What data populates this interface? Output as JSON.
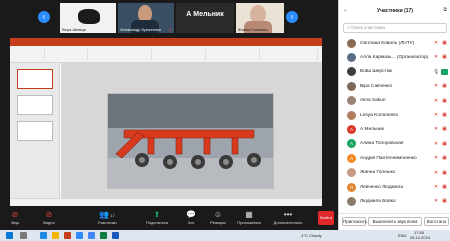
{
  "video_strip": {
    "tiles": [
      {
        "name": "Вера Шевчук"
      },
      {
        "name": "Олександр Христенко"
      },
      {
        "name": "А Мельник"
      },
      {
        "name": "Жанна Голешко"
      }
    ]
  },
  "participants": {
    "title": "Участники (17)",
    "search_placeholder": "Поиск участника",
    "list": [
      {
        "name": "Світлана Коваль (ЛНТУ)",
        "initial": "",
        "color": "#8a6a4f",
        "mic": "off",
        "cam": "off"
      },
      {
        "name": "Алла Кармазь... (Организатор)",
        "initial": "",
        "color": "#5a6d86",
        "mic": "off",
        "cam": "off"
      },
      {
        "name": "Вова Шерстюк",
        "initial": "",
        "color": "#3f3f3f",
        "mic": "on",
        "cam": "on"
      },
      {
        "name": "Віра Савченко",
        "initial": "",
        "color": "#7d6a5a",
        "mic": "off",
        "cam": "off"
      },
      {
        "name": "Alina Sakun",
        "initial": "",
        "color": "#9a8375",
        "mic": "off",
        "cam": "off"
      },
      {
        "name": "Lesya Kononenko",
        "initial": "",
        "color": "#b07d62",
        "mic": "off",
        "cam": "off"
      },
      {
        "name": "А Мельник",
        "initial": "А",
        "color": "#d9362b",
        "mic": "off",
        "cam": "off"
      },
      {
        "name": "Алина Топоровская",
        "initial": "А",
        "color": "#19a365",
        "mic": "off",
        "cam": "off"
      },
      {
        "name": "Андрій Пантелеймоненко",
        "initial": "А",
        "color": "#f08a24",
        "mic": "off",
        "cam": "off"
      },
      {
        "name": "Жанна Голешко",
        "initial": "",
        "color": "#c89a82",
        "mic": "off",
        "cam": "off"
      },
      {
        "name": "Левченко Людмила",
        "initial": "Л",
        "color": "#e3852e",
        "mic": "off",
        "cam": "off"
      },
      {
        "name": "Людмила Бойко",
        "initial": "",
        "color": "#8b7b6b",
        "mic": "off",
        "cam": "off"
      }
    ],
    "buttons": {
      "invite": "Пригласить",
      "mute_all": "Выключить звук всем",
      "restore": "Восстано"
    }
  },
  "toolbar": {
    "audio": "Звук",
    "video": "Видео",
    "participants": "Участники",
    "participants_count": "17",
    "share": "Поделиться",
    "chat": "Чат",
    "reactions": "Реакции",
    "apps": "Приложения",
    "more": "Дополнительно",
    "end": "Выйти"
  },
  "taskbar": {
    "weather": "-1°C Cloudy",
    "time": "17:55",
    "date": "05.12.2024",
    "lang": "ENG"
  },
  "colors": {
    "accent": "#2d8cff",
    "danger": "#d93025",
    "powerpoint": "#c43e1c"
  }
}
